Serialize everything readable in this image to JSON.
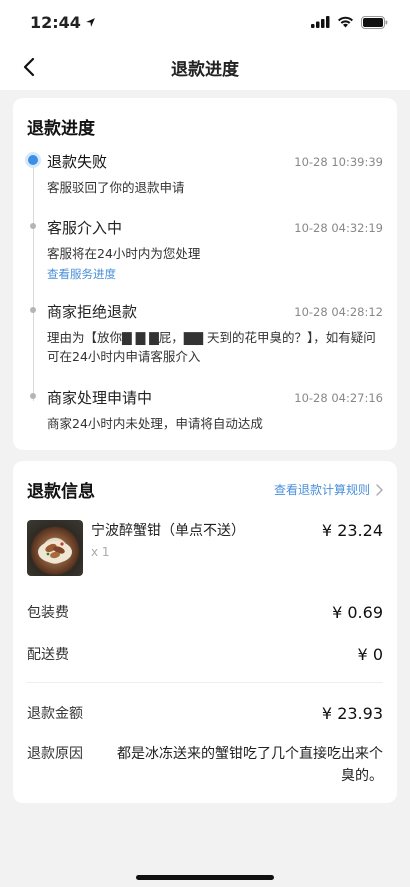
{
  "status_bar": {
    "time": "12:44"
  },
  "nav": {
    "title": "退款进度"
  },
  "progress": {
    "title": "退款进度",
    "events": [
      {
        "title": "退款失败",
        "time": "10-28 10:39:39",
        "desc": "客服驳回了你的退款申请",
        "link": ""
      },
      {
        "title": "客服介入中",
        "time": "10-28 04:32:19",
        "desc": "客服将在24小时内为您处理",
        "link": "查看服务进度"
      },
      {
        "title": "商家拒绝退款",
        "time": "10-28 04:28:12",
        "desc": "理由为【放你▇ ▇ ▇屁，▇▇ 天到的花甲臭的？】，如有疑问可在24小时内申请客服介入",
        "link": ""
      },
      {
        "title": "商家处理申请中",
        "time": "10-28 04:27:16",
        "desc": "商家24小时内未处理，申请将自动达成",
        "link": ""
      }
    ]
  },
  "refund_info": {
    "title": "退款信息",
    "calc_rule_label": "查看退款计算规则",
    "product": {
      "name": "宁波醉蟹钳（单点不送）",
      "qty": "x 1",
      "price": "¥ 23.24"
    },
    "packaging": {
      "label": "包装费",
      "value": "¥ 0.69"
    },
    "delivery": {
      "label": "配送费",
      "value": "¥ 0"
    },
    "amount": {
      "label": "退款金额",
      "value": "¥ 23.93"
    },
    "reason": {
      "label": "退款原因",
      "value": "都是冰冻送来的蟹钳吃了几个直接吃出来个臭的。"
    }
  }
}
